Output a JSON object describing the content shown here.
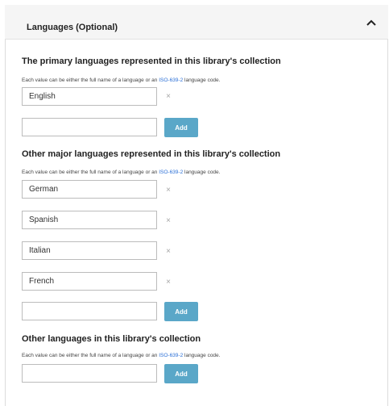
{
  "header": {
    "title": "Languages (Optional)",
    "toggle_icon": "chevron-up-icon"
  },
  "help_text": {
    "prefix": "Each value can be either the full name of a language or an ",
    "link": "ISO-639-2",
    "suffix": " language code."
  },
  "primary": {
    "title": "The primary languages represented in this library's collection",
    "values": [
      "English"
    ],
    "new_value": "",
    "add_label": "Add"
  },
  "other_major": {
    "title": "Other major languages represented in this library's collection",
    "values": [
      "German",
      "Spanish",
      "Italian",
      "French"
    ],
    "new_value": "",
    "add_label": "Add"
  },
  "other": {
    "title": "Other languages in this library's collection",
    "new_value": "",
    "add_label": "Add"
  },
  "remove_glyph": "×",
  "colors": {
    "accent_button": "#5aa7c8",
    "link": "#2a6fd6",
    "header_bg": "#f5f5f5"
  }
}
